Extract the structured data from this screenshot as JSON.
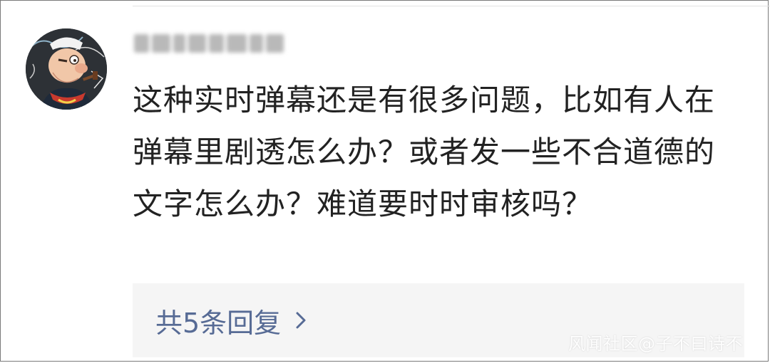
{
  "comment": {
    "avatar": {
      "icon": "cartoon-sailor-avatar"
    },
    "username": {
      "state": "blurred"
    },
    "text": "这种实时弹幕还是有很多问题，比如有人在弹幕里剧透怎么办？或者发一些不合道德的文字怎么办？难道要时时审核吗？",
    "replies": {
      "label": "共5条回复",
      "icon": "chevron-right-icon"
    }
  },
  "watermark": "风闻社区@子不曰诗不",
  "colors": {
    "text": "#222222",
    "link": "#576b95",
    "reply_bg": "#f5f5f5"
  }
}
